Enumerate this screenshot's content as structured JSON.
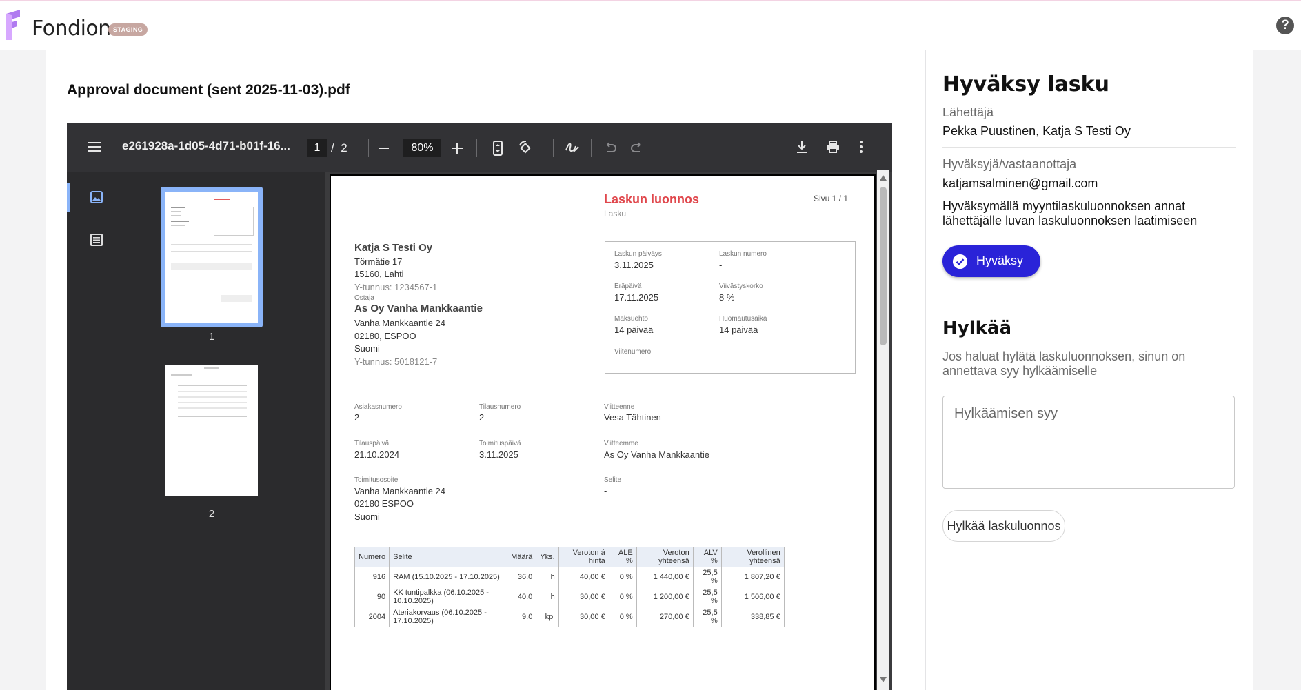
{
  "app": {
    "brand": "Fondion",
    "env_badge": "STAGING"
  },
  "document": {
    "title": "Approval document (sent 2025-11-03).pdf"
  },
  "viewer": {
    "filename": "e261928a-1d05-4d71-b01f-16...",
    "page_current": "1",
    "page_separator": "/",
    "page_total": "2",
    "zoom": "80%",
    "thumb_labels": [
      "1",
      "2"
    ]
  },
  "invoice": {
    "heading": "Laskun luonnos",
    "subheading": "Lasku",
    "page_info": "Sivu 1 / 1",
    "seller": {
      "name": "Katja S Testi Oy",
      "street": "Törmätie 17",
      "city": "15160, Lahti",
      "business_id": "Y-tunnus: 1234567-1"
    },
    "buyer_label": "Ostaja",
    "buyer": {
      "name": "As Oy Vanha Mankkaantie",
      "street": "Vanha Mankkaantie 24",
      "city": "02180, ESPOO",
      "country": "Suomi",
      "business_id": "Y-tunnus: 5018121-7"
    },
    "box": {
      "invoice_date_label": "Laskun päiväys",
      "invoice_date": "3.11.2025",
      "invoice_number_label": "Laskun numero",
      "invoice_number": "-",
      "due_date_label": "Eräpäivä",
      "due_date": "17.11.2025",
      "penalty_label": "Viivästyskorko",
      "penalty": "8 %",
      "terms_label": "Maksuehto",
      "terms": "14 päivää",
      "notice_label": "Huomautusaika",
      "notice": "14 päivää",
      "reference_label": "Viitenumero"
    },
    "details": {
      "customer_no_label": "Asiakasnumero",
      "customer_no": "2",
      "order_no_label": "Tilausnumero",
      "order_no": "2",
      "your_ref_label": "Viitteenne",
      "your_ref": "Vesa Tähtinen",
      "order_date_label": "Tilauspäivä",
      "order_date": "21.10.2024",
      "delivery_date_label": "Toimituspäivä",
      "delivery_date": "3.11.2025",
      "our_ref_label": "Viitteemme",
      "our_ref": "As Oy Vanha Mankkaantie",
      "delivery_addr_label": "Toimitusosoite",
      "delivery_street": "Vanha Mankkaantie 24",
      "delivery_city": "02180 ESPOO",
      "delivery_country": "Suomi",
      "note_label": "Selite",
      "note": "-"
    },
    "table": {
      "headers": [
        "Numero",
        "Selite",
        "Määrä",
        "Yks.",
        "Veroton á hinta",
        "ALE %",
        "Veroton yhteensä",
        "ALV %",
        "Verollinen yhteensä"
      ],
      "rows": [
        [
          "916",
          "RAM (15.10.2025 - 17.10.2025)",
          "36.0",
          "h",
          "40,00 €",
          "0 %",
          "1 440,00 €",
          "25,5 %",
          "1 807,20 €"
        ],
        [
          "90",
          "KK tuntipalkka (06.10.2025 - 10.10.2025)",
          "40.0",
          "h",
          "30,00 €",
          "0 %",
          "1 200,00 €",
          "25,5 %",
          "1 506,00 €"
        ],
        [
          "2004",
          "Ateriakorvaus (06.10.2025 - 17.10.2025)",
          "9.0",
          "kpl",
          "30,00 €",
          "0 %",
          "270,00 €",
          "25,5 %",
          "338,85 €"
        ]
      ]
    }
  },
  "approval": {
    "title": "Hyväksy lasku",
    "sender_label": "Lähettäjä",
    "sender": "Pekka Puustinen, Katja S Testi Oy",
    "approver_label": "Hyväksyjä/vastaanottaja",
    "approver": "katjamsalminen@gmail.com",
    "description_line1": "Hyväksymällä myyntilaskuluonnoksen annat",
    "description_line2": "lähettäjälle luvan laskuluonnoksen laatimiseen",
    "approve_button": "Hyväksy",
    "reject_title": "Hylkää",
    "reject_info_line1": "Jos haluat hylätä laskuluonnoksen, sinun on",
    "reject_info_line2": "annettava syy hylkäämiselle",
    "reject_placeholder": "Hylkäämisen syy",
    "reject_button": "Hylkää laskuluonnos"
  }
}
